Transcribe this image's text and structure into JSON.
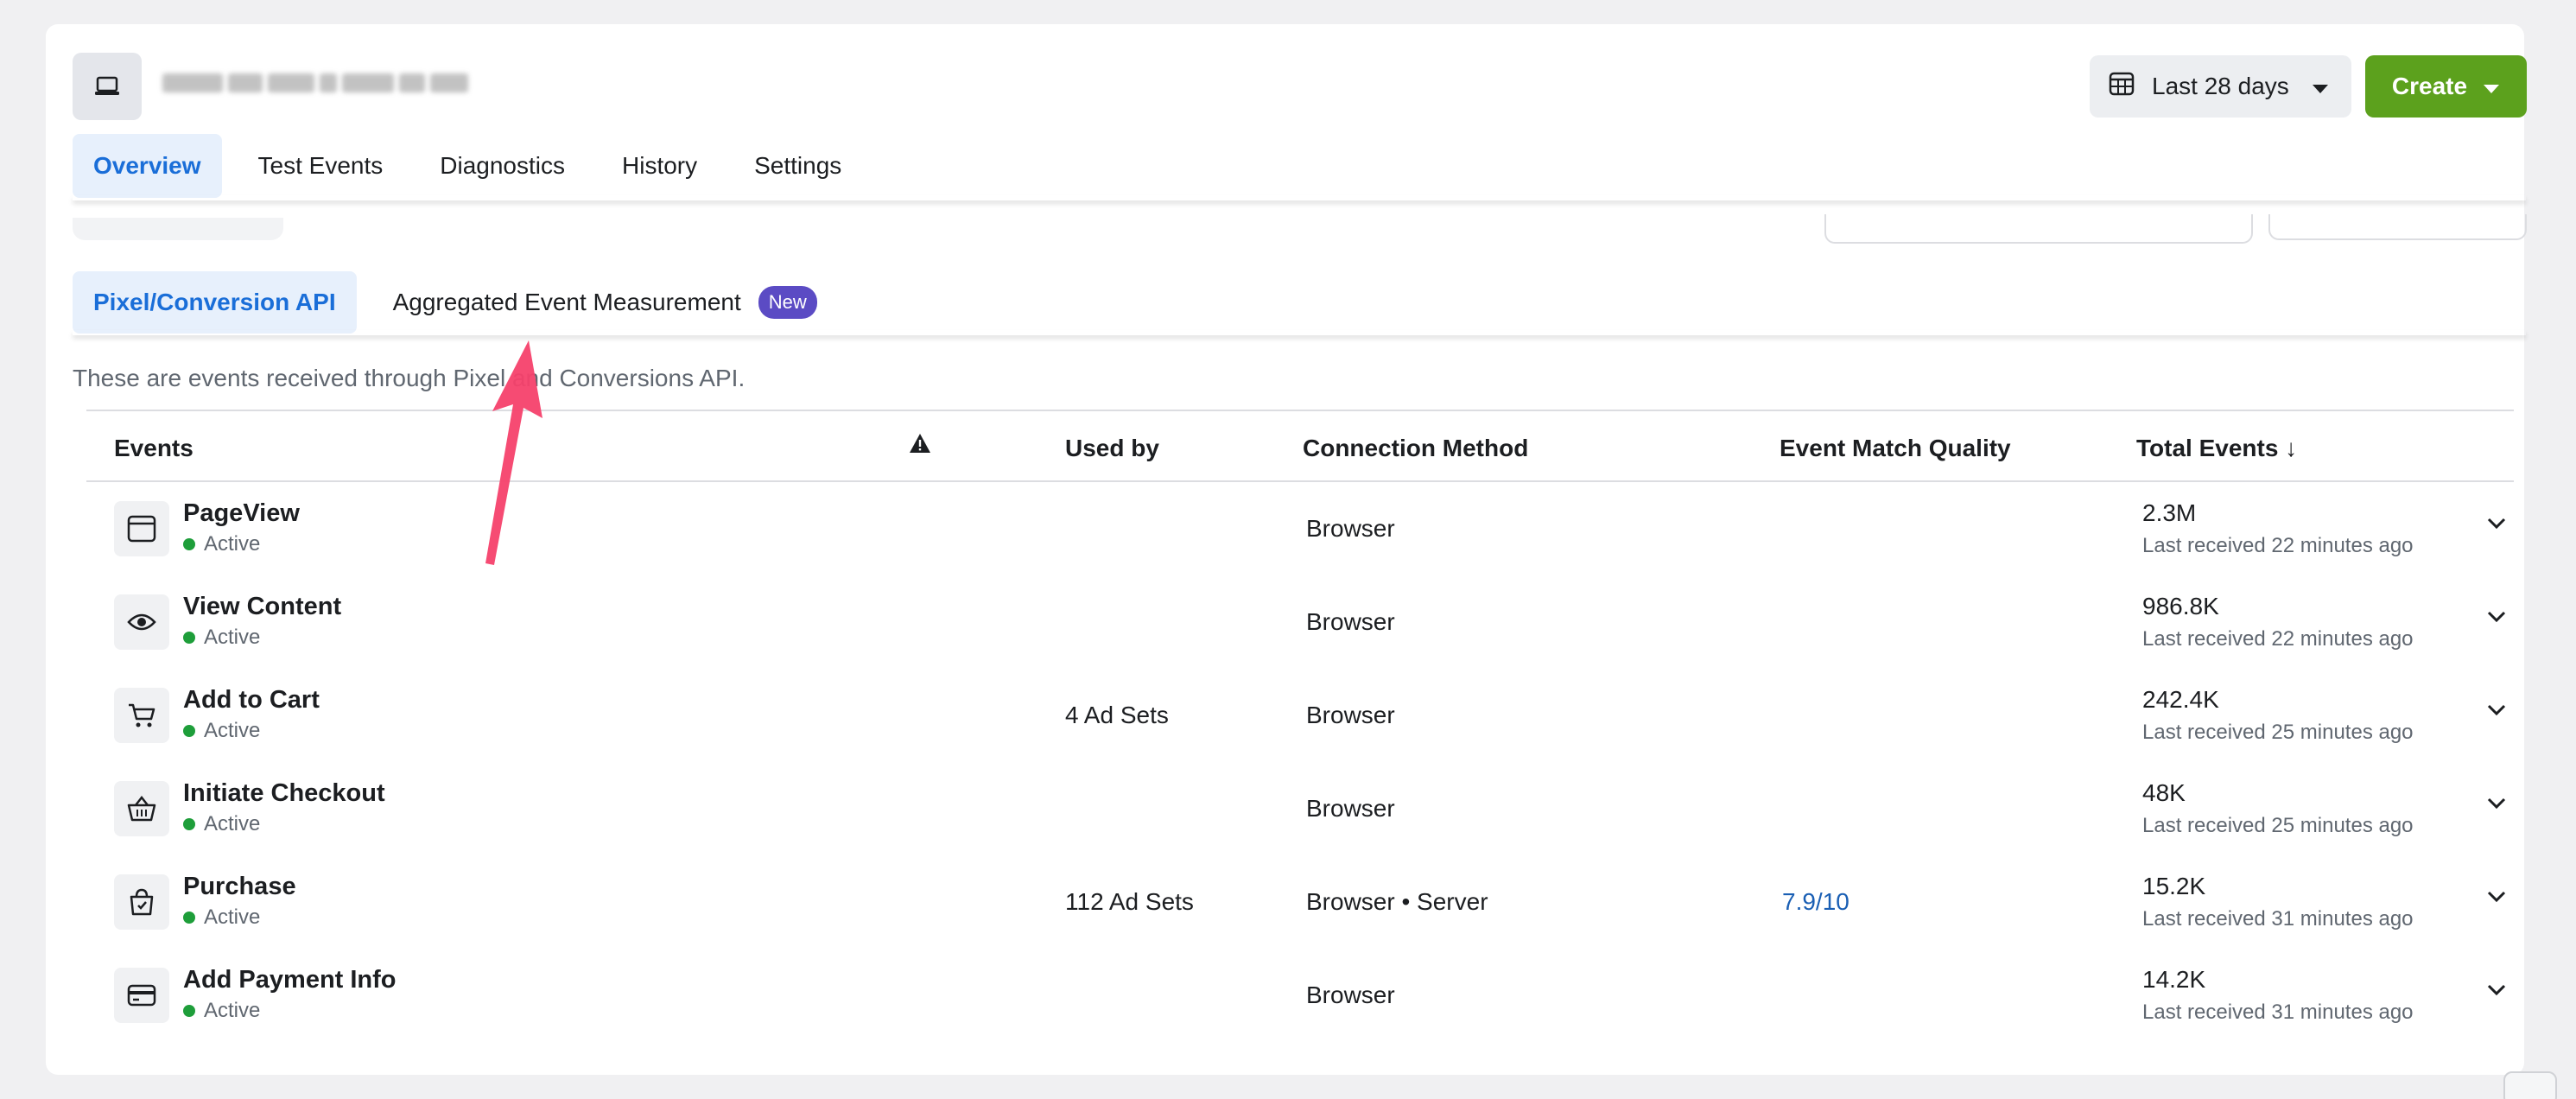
{
  "header": {
    "date_range_label": "Last 28 days",
    "create_label": "Create",
    "icons": {
      "app": "laptop-icon",
      "date": "calendar-grid-icon",
      "caret": "caret-down-icon"
    }
  },
  "tabs": [
    {
      "label": "Overview",
      "active": true
    },
    {
      "label": "Test Events",
      "active": false
    },
    {
      "label": "Diagnostics",
      "active": false
    },
    {
      "label": "History",
      "active": false
    },
    {
      "label": "Settings",
      "active": false
    }
  ],
  "subtabs": [
    {
      "label": "Pixel/Conversion API",
      "active": true
    },
    {
      "label": "Aggregated Event Measurement",
      "active": false,
      "badge": "New"
    }
  ],
  "description": "These are events received through Pixel and Conversions API.",
  "table": {
    "columns": {
      "events": "Events",
      "warning": "warning-icon",
      "used_by": "Used by",
      "connection": "Connection Method",
      "quality": "Event Match Quality",
      "total": "Total Events ↓"
    },
    "rows": [
      {
        "name": "PageView",
        "status": "Active",
        "icon": "browser-window-icon",
        "used_by": "",
        "connection": "Browser",
        "quality": "",
        "total": "2.3M",
        "last": "Last received 22 minutes ago"
      },
      {
        "name": "View Content",
        "status": "Active",
        "icon": "eye-icon",
        "used_by": "",
        "connection": "Browser",
        "quality": "",
        "total": "986.8K",
        "last": "Last received 22 minutes ago"
      },
      {
        "name": "Add to Cart",
        "status": "Active",
        "icon": "cart-icon",
        "used_by": "4 Ad Sets",
        "connection": "Browser",
        "quality": "",
        "total": "242.4K",
        "last": "Last received 25 minutes ago"
      },
      {
        "name": "Initiate Checkout",
        "status": "Active",
        "icon": "basket-icon",
        "used_by": "",
        "connection": "Browser",
        "quality": "",
        "total": "48K",
        "last": "Last received 25 minutes ago"
      },
      {
        "name": "Purchase",
        "status": "Active",
        "icon": "shopping-bag-icon",
        "used_by": "112 Ad Sets",
        "connection": "Browser • Server",
        "quality": "7.9/10",
        "total": "15.2K",
        "last": "Last received 31 minutes ago"
      },
      {
        "name": "Add Payment Info",
        "status": "Active",
        "icon": "credit-card-icon",
        "used_by": "",
        "connection": "Browser",
        "quality": "",
        "total": "14.2K",
        "last": "Last received 31 minutes ago"
      }
    ]
  },
  "colors": {
    "primary_blue": "#1a6ed8",
    "create_green": "#5ca11d",
    "badge_purple": "#5b4bc4",
    "active_dot": "#1e9e3a",
    "annotation_arrow": "#f5416c"
  }
}
